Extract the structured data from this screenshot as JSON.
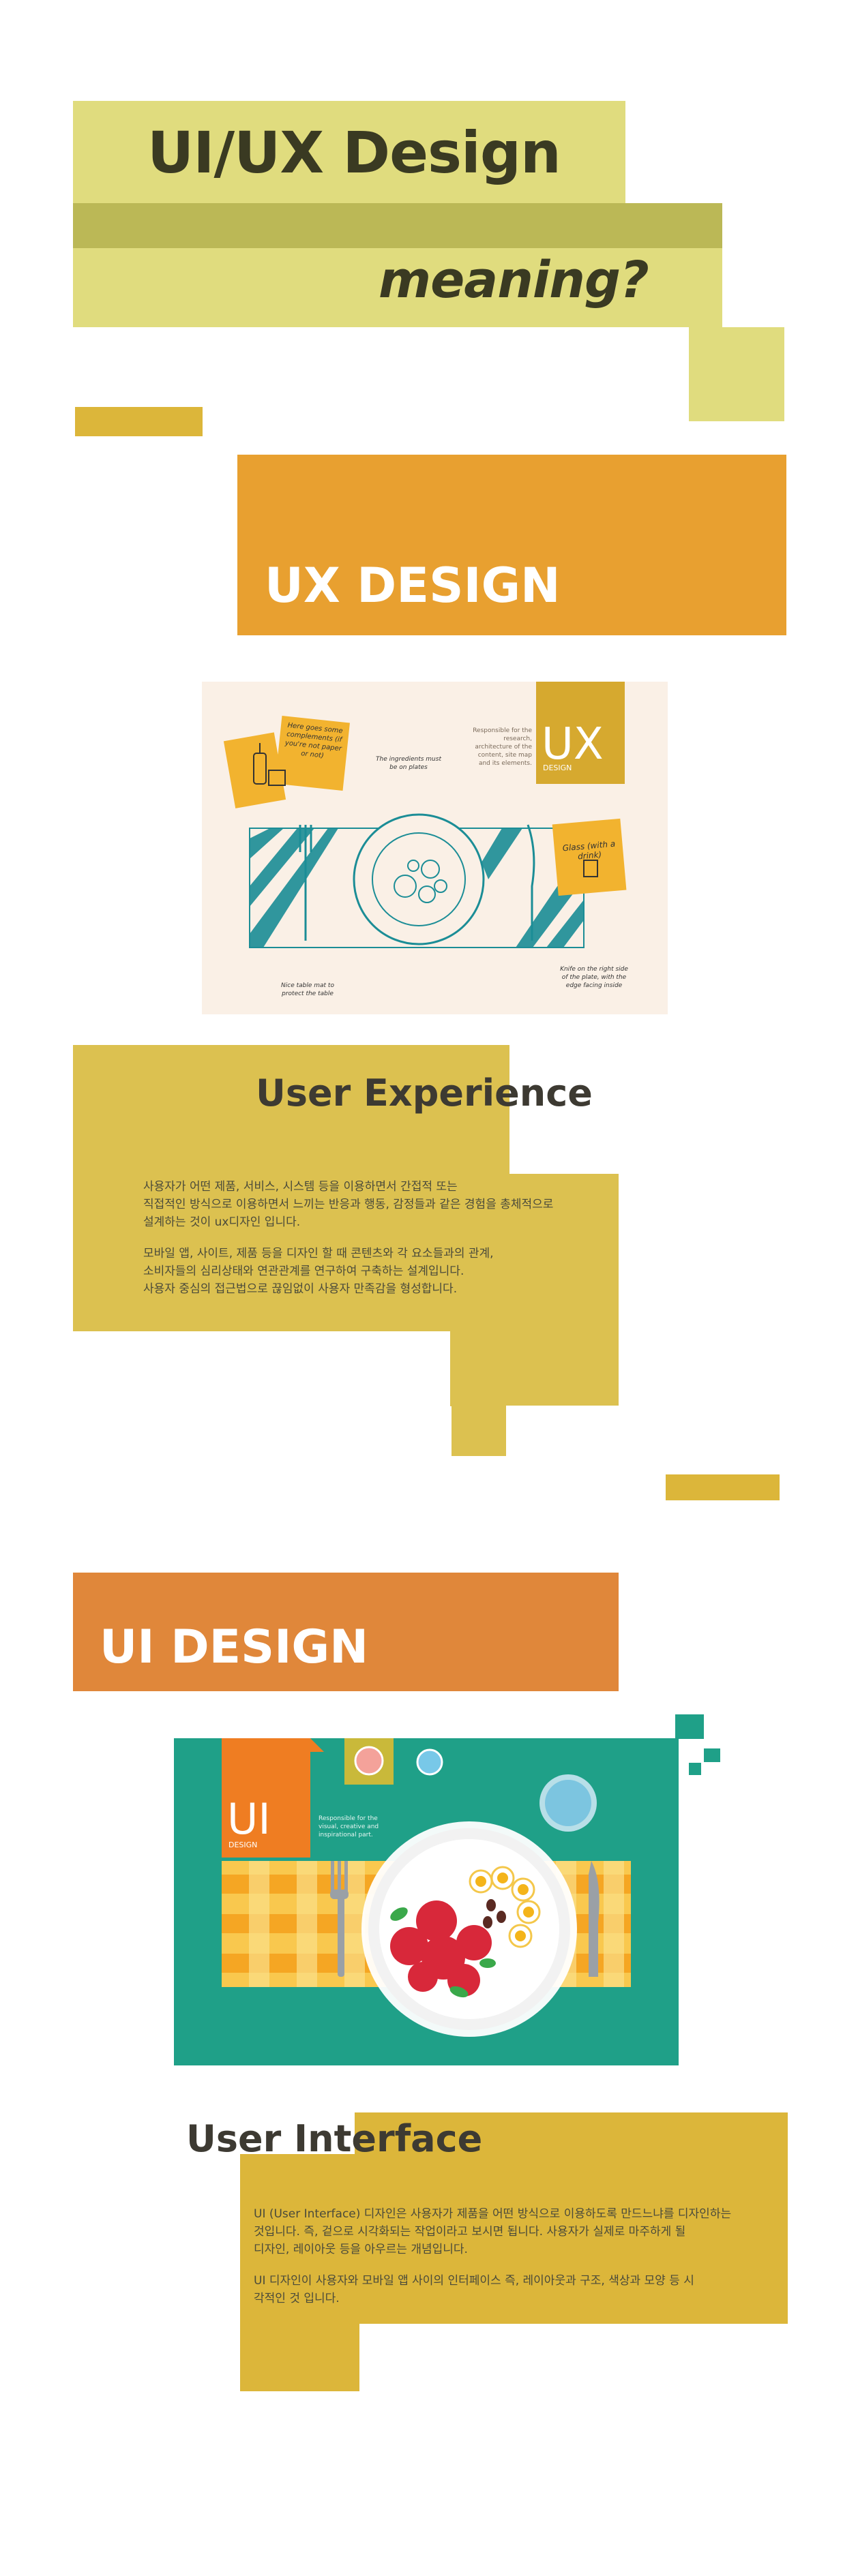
{
  "title": {
    "line1": "UI/UX Design",
    "line2": "meaning?"
  },
  "ux_section": {
    "banner_label": "UX DESIGN",
    "card": {
      "badge": "UX",
      "badge_sub": "DESIGN",
      "desc": "Responsible for the research, architecture of the content, site map and its elements.",
      "note_left": "Here goes some complements (if you're not paper or not)",
      "note_ingredients": "The ingredients must be on plates",
      "note_glass": "Glass (with a drink)",
      "note_table": "Nice table mat to protect the table",
      "note_knife": "Knife on the right side of the plate, with the edge facing inside"
    },
    "heading": "User Experience",
    "paragraph1": "사용자가 어떤 제품, 서비스, 시스템 등을 이용하면서 간접적 또는\n직접적인 방식으로 이용하면서 느끼는 반응과 행동, 감정들과 같은 경험을 총체적으로\n설계하는 것이 ux디자인 입니다.",
    "paragraph2": "모바일 앱, 사이트, 제품 등을 디자인 할 때 콘텐츠와 각 요소들과의 관계,\n소비자들의 심리상태와 연관관계를 연구하여 구축하는 설계입니다.\n사용자 중심의 접근법으로 끊임없이 사용자 만족감을 형성합니다."
  },
  "ui_section": {
    "banner_label": "UI DESIGN",
    "card": {
      "badge": "UI",
      "badge_sub": "DESIGN",
      "desc": "Responsible for the visual, creative and inspirational part."
    },
    "heading": "User Interface",
    "paragraph1": "UI (User Interface) 디자인은 사용자가 제품을 어떤 방식으로 이용하도록 만드느냐를 디자인하는\n것입니다. 즉, 겉으로 시각화되는 작업이라고 보시면 됩니다. 사용자가 실제로 마주하게 될\n디자인, 레이아웃 등을 아우르는 개념입니다.",
    "paragraph2": "UI 디자인이 사용자와 모바일 앱 사이의 인터페이스 즉, 레이아웃과 구조, 색상과 모양 등 시\n각적인 것 입니다."
  },
  "colors": {
    "lime_light": "#e0dc7e",
    "lime_dark": "#bbb856",
    "mustard": "#dcb63a",
    "orange": "#e8a030",
    "orange_dark": "#e0873a",
    "teal": "#1fa088",
    "cream": "#faf0e6"
  }
}
